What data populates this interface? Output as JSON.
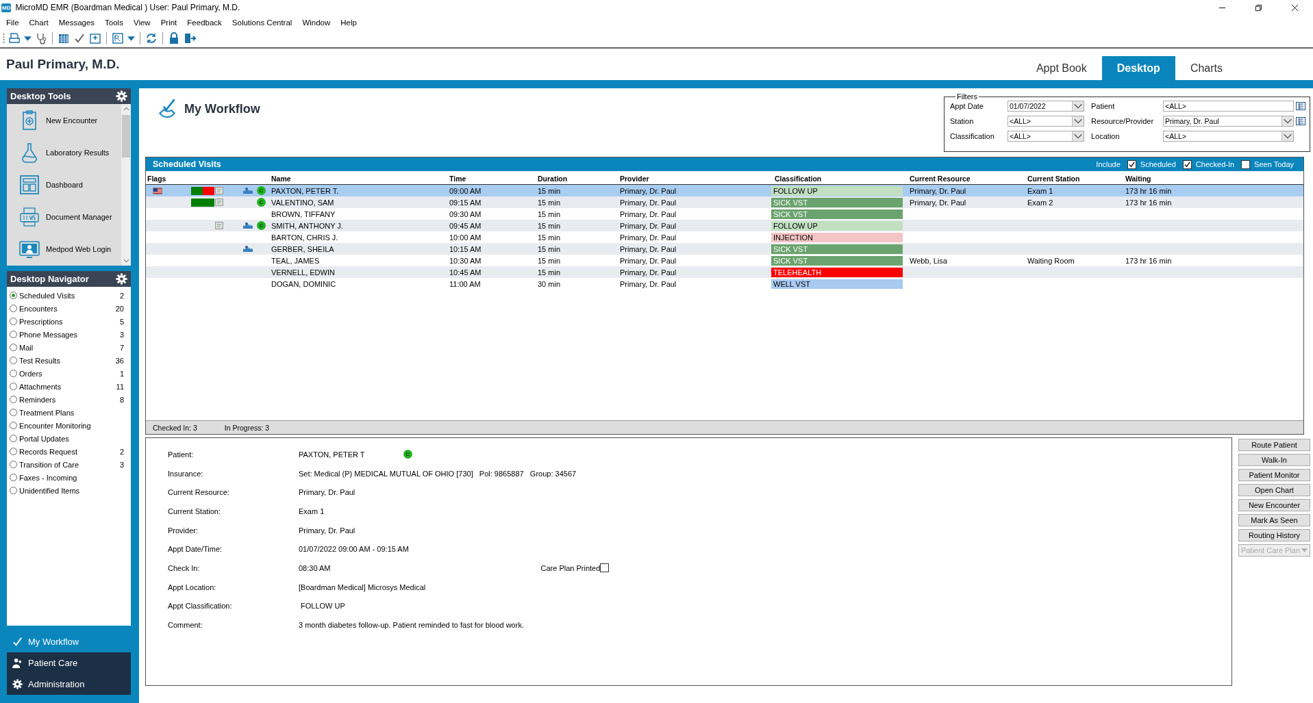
{
  "window": {
    "title": "MicroMD EMR (Boardman Medical )  User: Paul Primary, M.D.",
    "logo": "MD"
  },
  "menu": [
    "File",
    "Chart",
    "Messages",
    "Tools",
    "View",
    "Print",
    "Feedback",
    "Solutions Central",
    "Window",
    "Help"
  ],
  "header": {
    "user": "Paul Primary, M.D.",
    "tabs": [
      {
        "label": "Appt Book",
        "selected": false
      },
      {
        "label": "Desktop",
        "selected": true
      },
      {
        "label": "Charts",
        "selected": false
      }
    ]
  },
  "desktop_tools": {
    "title": "Desktop Tools",
    "items": [
      "New Encounter",
      "Laboratory Results",
      "Dashboard",
      "Document Manager",
      "Medpod Web Login"
    ]
  },
  "desktop_navigator": {
    "title": "Desktop Navigator",
    "items": [
      {
        "label": "Scheduled Visits",
        "count": "2",
        "selected": true
      },
      {
        "label": "Encounters",
        "count": "20",
        "selected": false
      },
      {
        "label": "Prescriptions",
        "count": "5",
        "selected": false
      },
      {
        "label": "Phone Messages",
        "count": "3",
        "selected": false
      },
      {
        "label": "Mail",
        "count": "7",
        "selected": false
      },
      {
        "label": "Test Results",
        "count": "36",
        "selected": false
      },
      {
        "label": "Orders",
        "count": "1",
        "selected": false
      },
      {
        "label": "Attachments",
        "count": "11",
        "selected": false
      },
      {
        "label": "Reminders",
        "count": "8",
        "selected": false
      },
      {
        "label": "Treatment Plans",
        "selected": false
      },
      {
        "label": "Encounter Monitoring",
        "selected": false
      },
      {
        "label": "Portal Updates",
        "selected": false
      },
      {
        "label": "Records Request",
        "count": "2",
        "selected": false
      },
      {
        "label": "Transition of Care",
        "count": "3",
        "selected": false
      },
      {
        "label": "Faxes - Incoming",
        "selected": false
      },
      {
        "label": "Unidentified Items",
        "selected": false
      }
    ]
  },
  "modules": [
    {
      "label": "My Workflow",
      "selected": true
    },
    {
      "label": "Patient Care",
      "selected": false
    },
    {
      "label": "Administration",
      "selected": false
    }
  ],
  "page_title": "My Workflow",
  "filters": {
    "title": "Filters",
    "fields": [
      {
        "label": "Appt Date",
        "value": "01/07/2022",
        "kind": "dropdown"
      },
      {
        "label": "Patient",
        "value": "<ALL>",
        "kind": "lookup"
      },
      {
        "label": "Station",
        "value": "<ALL>",
        "kind": "dropdown"
      },
      {
        "label": "Resource/Provider",
        "value": "Primary, Dr. Paul",
        "kind": "dropdown-lookup"
      },
      {
        "label": "Classification",
        "value": "<ALL>",
        "kind": "dropdown"
      },
      {
        "label": "Location",
        "value": "<ALL>",
        "kind": "dropdown"
      }
    ]
  },
  "scheduled_visits": {
    "title": "Scheduled Visits",
    "include_label": "Include",
    "include": [
      {
        "label": "Scheduled",
        "checked": true
      },
      {
        "label": "Checked-In",
        "checked": true
      },
      {
        "label": "Seen Today",
        "checked": false
      }
    ],
    "columns": [
      "Flags",
      "Name",
      "Time",
      "Duration",
      "Provider",
      "Classification",
      "Current Resource",
      "Current Station",
      "Waiting"
    ],
    "rows": [
      {
        "selected": true,
        "flag": true,
        "status_bars": [
          {
            "color": "#008000"
          },
          {
            "color": "#ff0000"
          }
        ],
        "note": true,
        "card": true,
        "badge": "C",
        "name": "PAXTON, PETER T.",
        "time": "09:00 AM",
        "duration": "15 min",
        "provider": "Primary, Dr. Paul",
        "classification": {
          "label": "FOLLOW UP",
          "color": "#c2dfc2"
        },
        "resource": "Primary, Dr. Paul",
        "station": "Exam 1",
        "waiting": "173 hr 16 min"
      },
      {
        "selected": false,
        "flag": false,
        "status_bars": [
          {
            "color": "#008000"
          }
        ],
        "note": true,
        "card": false,
        "badge": "C",
        "name": "VALENTINO, SAM",
        "time": "09:15 AM",
        "duration": "15 min",
        "provider": "Primary, Dr. Paul",
        "classification": {
          "label": "SICK VST",
          "color": "#6aa36d"
        },
        "resource": "Primary, Dr. Paul",
        "station": "Exam 2",
        "waiting": "173 hr 16 min"
      },
      {
        "selected": false,
        "flag": false,
        "note": false,
        "card": false,
        "name": "BROWN, TIFFANY",
        "time": "09:30 AM",
        "duration": "15 min",
        "provider": "Primary, Dr. Paul",
        "classification": {
          "label": "SICK VST",
          "color": "#6aa36d"
        }
      },
      {
        "selected": false,
        "flag": false,
        "note": true,
        "card": true,
        "badge": "C",
        "name": "SMITH, ANTHONY J.",
        "time": "09:45 AM",
        "duration": "15 min",
        "provider": "Primary, Dr. Paul",
        "classification": {
          "label": "FOLLOW UP",
          "color": "#c2dfc2"
        }
      },
      {
        "selected": false,
        "flag": false,
        "note": false,
        "card": false,
        "name": "BARTON, CHRIS J.",
        "time": "10:00 AM",
        "duration": "15 min",
        "provider": "Primary, Dr. Paul",
        "classification": {
          "label": "INJECTION",
          "color": "#f4c4c4"
        }
      },
      {
        "selected": false,
        "flag": false,
        "note": false,
        "card": true,
        "name": "GERBER, SHEILA",
        "time": "10:15 AM",
        "duration": "15 min",
        "provider": "Primary, Dr. Paul",
        "classification": {
          "label": "SICK VST",
          "color": "#6aa36d"
        }
      },
      {
        "selected": false,
        "flag": false,
        "note": false,
        "card": false,
        "name": "TEAL, JAMES",
        "time": "10:30 AM",
        "duration": "15 min",
        "provider": "Primary, Dr. Paul",
        "classification": {
          "label": "SICK VST",
          "color": "#6aa36d"
        },
        "resource": "Webb,  Lisa",
        "station": "Waiting Room",
        "waiting": "173 hr 16 min"
      },
      {
        "selected": false,
        "flag": false,
        "note": false,
        "card": false,
        "name": "VERNELL, EDWIN",
        "time": "10:45 AM",
        "duration": "15 min",
        "provider": "Primary, Dr. Paul",
        "classification": {
          "label": "TELEHEALTH",
          "color": "#ff0000"
        }
      },
      {
        "selected": false,
        "flag": false,
        "note": false,
        "card": false,
        "name": "DOGAN, DOMINIC",
        "time": "11:00 AM",
        "duration": "30 min",
        "provider": "Primary, Dr. Paul",
        "classification": {
          "label": "WELL VST",
          "color": "#a9caf1"
        }
      }
    ],
    "footer": [
      "Checked In: 3",
      "In Progress: 3"
    ]
  },
  "details": {
    "fields": [
      {
        "label": "Patient:",
        "value": "PAXTON, PETER T",
        "badge": "C"
      },
      {
        "label": "Insurance:",
        "value": "Set: Medical (P) MEDICAL MUTUAL OF OHIO [730]   Pol: 9865887   Group: 34567"
      },
      {
        "label": "Current Resource:",
        "value": "Primary, Dr. Paul"
      },
      {
        "label": "Current Station:",
        "value": "Exam 1"
      },
      {
        "label": "Provider:",
        "value": "Primary, Dr. Paul"
      },
      {
        "label": "Appt Date/Time:",
        "value": "01/07/2022 09:00 AM - 09:15 AM"
      },
      {
        "label": "Check In:",
        "value": "08:30 AM",
        "checkbox": {
          "label": "Care Plan Printed",
          "checked": false
        }
      },
      {
        "label": "Appt Location:",
        "value": "[Boardman Medical] Microsys Medical"
      },
      {
        "label": "Appt Classification:",
        "value": " FOLLOW UP"
      },
      {
        "label": "Comment:",
        "value": "3 month diabetes follow-up. Patient reminded to fast for blood work."
      }
    ]
  },
  "actions": [
    {
      "label": "Route Patient",
      "disabled": false
    },
    {
      "label": "Walk-In",
      "disabled": false
    },
    {
      "label": "Patient Monitor",
      "disabled": false
    },
    {
      "label": "Open Chart",
      "disabled": false
    },
    {
      "label": "New Encounter",
      "disabled": false
    },
    {
      "label": "Mark As Seen",
      "disabled": false
    },
    {
      "label": "Routing History",
      "disabled": false
    },
    {
      "label": "Patient Care Plan",
      "disabled": true,
      "kind": "dropdown"
    }
  ]
}
